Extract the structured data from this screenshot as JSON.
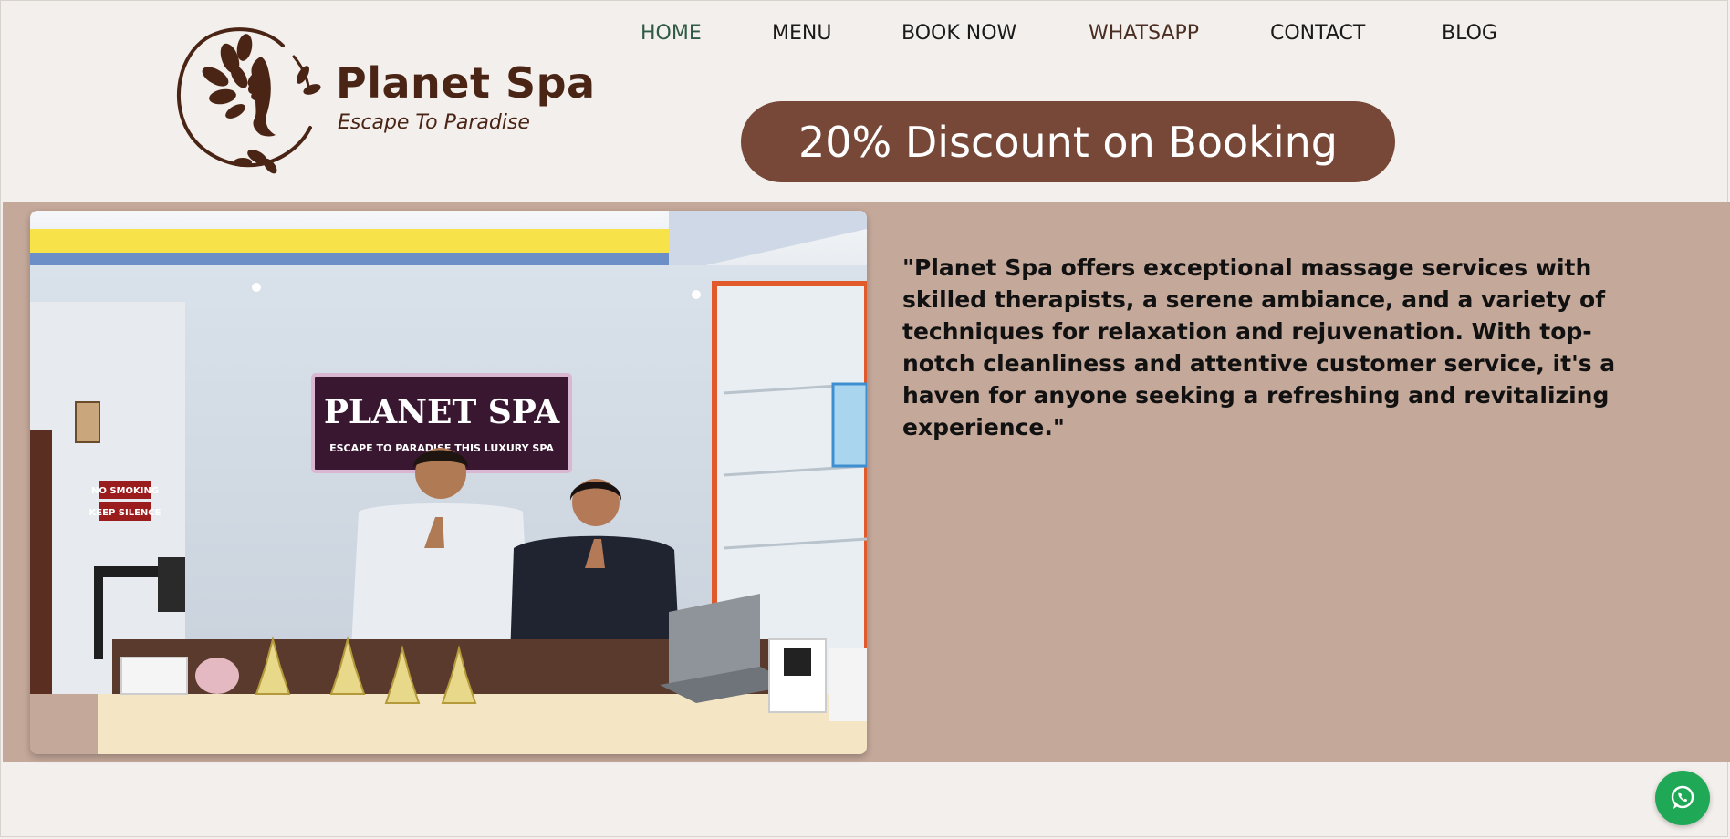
{
  "brand": {
    "name": "Planet Spa",
    "tagline": "Escape To Paradise"
  },
  "nav": {
    "items": [
      {
        "label": "HOME"
      },
      {
        "label": "MENU"
      },
      {
        "label": "BOOK NOW"
      },
      {
        "label": "WHATSAPP"
      },
      {
        "label": "CONTACT"
      },
      {
        "label": "BLOG"
      }
    ]
  },
  "banner": {
    "text": "20% Discount on Booking"
  },
  "photo": {
    "sign_title": "PLANET SPA",
    "sign_subtitle": "ESCAPE TO PARADISE THIS LUXURY SPA",
    "sign_no_smoking": "NO SMOKING",
    "sign_keep_silence": "KEEP SILENCE"
  },
  "main": {
    "quote": "\"Planet Spa offers exceptional massage services with skilled therapists, a serene ambiance, and a variety of techniques for relaxation and rejuvenation. With top-notch cleanliness and attentive customer service, it's a haven for anyone seeking a refreshing and revitalizing experience.\""
  },
  "colors": {
    "accent": "#774838",
    "band": "#c4a89a",
    "background": "#f3efec",
    "brand_text": "#4a2515",
    "whatsapp": "#1fa855"
  },
  "icons": {
    "logo": "woman-face-leaves-icon",
    "floating": "whatsapp-icon"
  }
}
